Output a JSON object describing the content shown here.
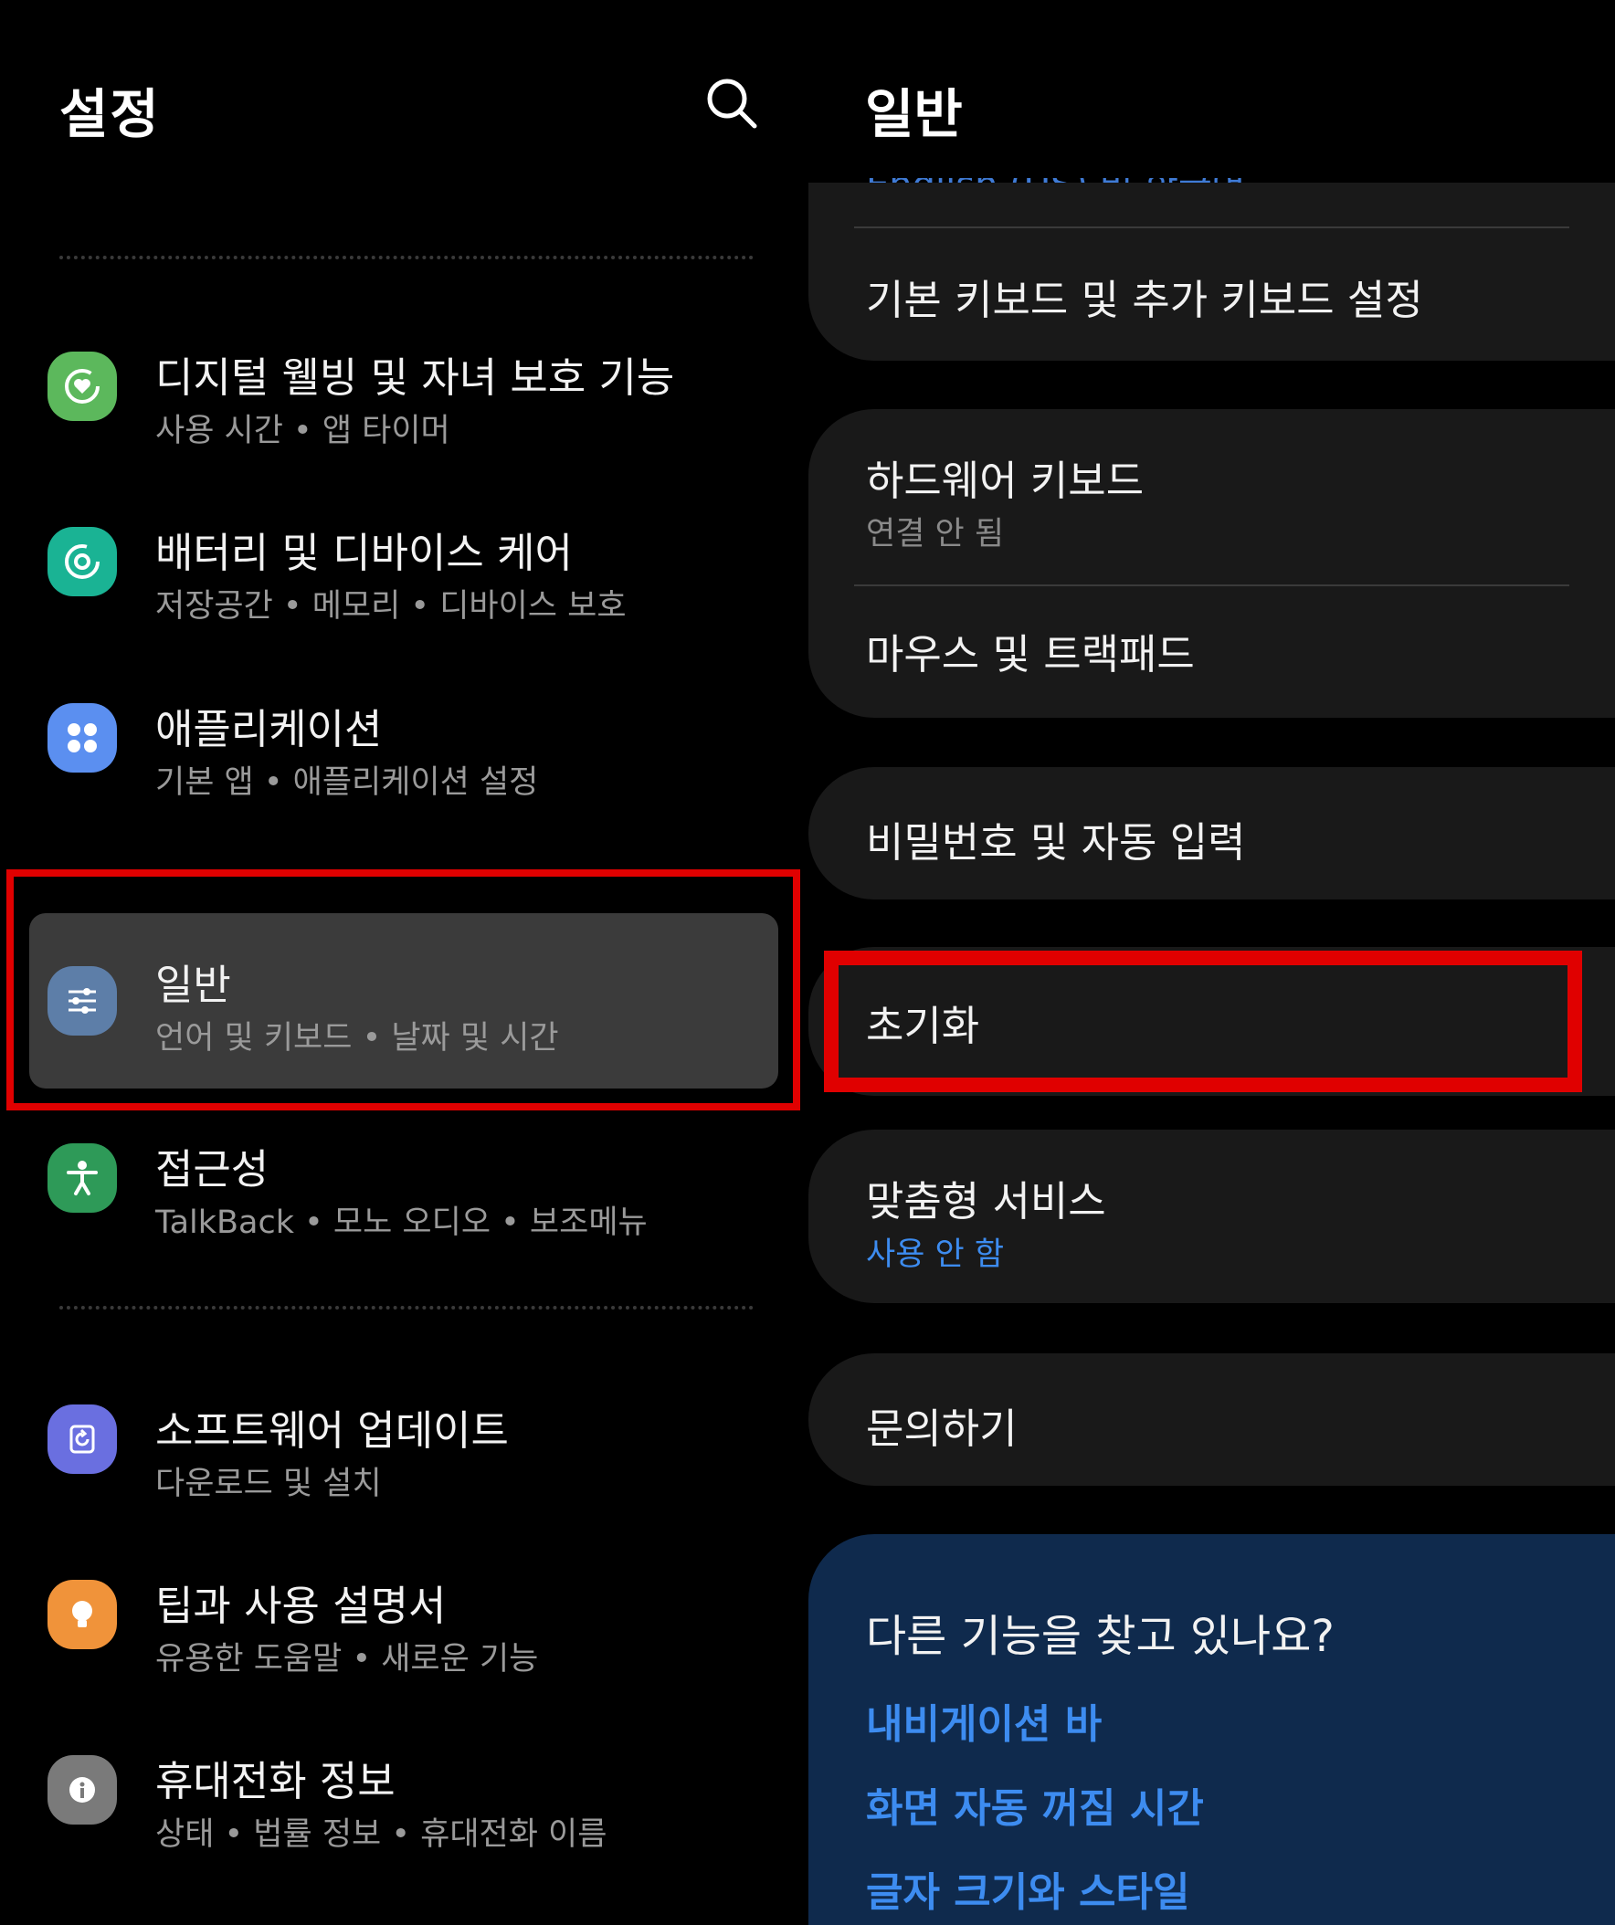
{
  "left": {
    "title": "설정",
    "items": [
      {
        "title": "디지털 웰빙 및 자녀 보호 기능",
        "subtitle": "사용 시간 • 앱 타이머",
        "icon": "digital-wellbeing-icon",
        "color": "#5cb85c"
      },
      {
        "title": "배터리 및 디바이스 케어",
        "subtitle": "저장공간 • 메모리 • 디바이스 보호",
        "icon": "device-care-icon",
        "color": "#1ab394"
      },
      {
        "title": "애플리케이션",
        "subtitle": "기본 앱 • 애플리케이션 설정",
        "icon": "apps-icon",
        "color": "#5b8ff0"
      },
      {
        "title": "일반",
        "subtitle": "언어 및 키보드 • 날짜 및 시간",
        "icon": "general-management-icon",
        "color": "#5d7ea8"
      },
      {
        "title": "접근성",
        "subtitle": "TalkBack • 모노 오디오 • 보조메뉴",
        "icon": "accessibility-icon",
        "color": "#2e9a58"
      },
      {
        "title": "소프트웨어 업데이트",
        "subtitle": "다운로드 및 설치",
        "icon": "software-update-icon",
        "color": "#6a6fe0"
      },
      {
        "title": "팁과 사용 설명서",
        "subtitle": "유용한 도움말 • 새로운 기능",
        "icon": "lightbulb-icon",
        "color": "#f0933a"
      },
      {
        "title": "휴대전화 정보",
        "subtitle": "상태 • 법률 정보 • 휴대전화 이름",
        "icon": "info-icon",
        "color": "#7a7a7a"
      }
    ]
  },
  "right": {
    "title": "일반",
    "peek_text": "English (US) 및 한국어",
    "keyboard_settings": "기본 키보드 및 추가 키보드 설정",
    "hardware_keyboard": {
      "title": "하드웨어 키보드",
      "subtitle": "연결 안 됨"
    },
    "mouse_trackpad": "마우스 및 트랙패드",
    "passwords_autofill": "비밀번호 및 자동 입력",
    "reset": "초기화",
    "customization": {
      "title": "맞춤형 서비스",
      "subtitle": "사용 안 함"
    },
    "contact_us": "문의하기",
    "suggestions": {
      "question": "다른 기능을 찾고 있나요?",
      "links": [
        "내비게이션 바",
        "화면 자동 꺼짐 시간",
        "글자 크기와 스타일"
      ]
    }
  },
  "colors": {
    "highlight": "#e00000",
    "link": "#3d8cf0",
    "background": "#000000",
    "card": "#191919"
  }
}
